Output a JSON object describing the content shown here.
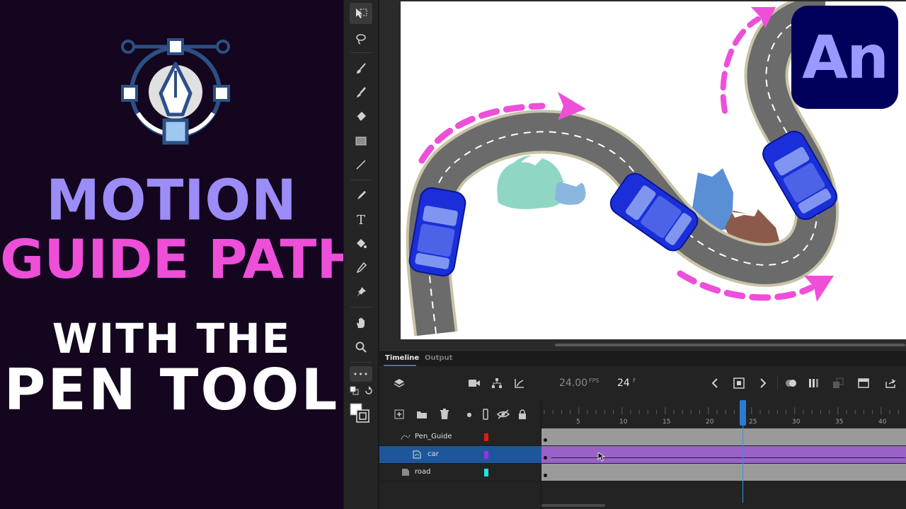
{
  "promo": {
    "title_line1": "MOTION",
    "title_line2": "GUIDE PATH",
    "subtitle_line1": "WITH THE",
    "subtitle_line2": "PEN TOOL",
    "colors": {
      "line1": "#9b8cf7",
      "line2": "#ee4fd8",
      "subtitle": "#ffffff",
      "background": "#13061e"
    }
  },
  "app_logo": {
    "text": "An",
    "bg": "#00005b",
    "fg": "#9999ff"
  },
  "toolbar": {
    "tools": [
      {
        "name": "selection-tool-icon",
        "glyph": "⬚"
      },
      {
        "name": "lasso-tool-icon",
        "glyph": "◌"
      },
      {
        "name": "fluid-brush-icon",
        "glyph": "✎"
      },
      {
        "name": "brush-tool-icon",
        "glyph": "🖌"
      },
      {
        "name": "eraser-tool-icon",
        "glyph": "◆"
      },
      {
        "name": "rectangle-tool-icon",
        "glyph": "■"
      },
      {
        "name": "line-tool-icon",
        "glyph": "╱"
      },
      {
        "name": "pen-tool-icon",
        "glyph": "✒"
      },
      {
        "name": "text-tool-icon",
        "glyph": "T"
      },
      {
        "name": "paint-bucket-icon",
        "glyph": "◈"
      },
      {
        "name": "eyedropper-icon",
        "glyph": "⌖"
      },
      {
        "name": "pin-tool-icon",
        "glyph": "⚲"
      },
      {
        "name": "hand-tool-icon",
        "glyph": "✋"
      },
      {
        "name": "zoom-tool-icon",
        "glyph": "⚲"
      },
      {
        "name": "more-tools-icon",
        "glyph": "•••"
      }
    ]
  },
  "timeline": {
    "tabs": [
      "Timeline",
      "Output"
    ],
    "fps_value": "24.00",
    "fps_unit": "FPS",
    "frame_value": "24",
    "frame_unit": "F",
    "ruler_numbers": [
      "5",
      "10",
      "15",
      "20",
      "25",
      "30",
      "35",
      "40"
    ],
    "current_frame": 25,
    "layers": [
      {
        "name": "Pen_Guide",
        "color": "#e01b1b",
        "selected": false
      },
      {
        "name": "car",
        "color": "#9b30e0",
        "selected": true
      },
      {
        "name": "road",
        "color": "#19e5e5",
        "selected": false
      }
    ]
  }
}
